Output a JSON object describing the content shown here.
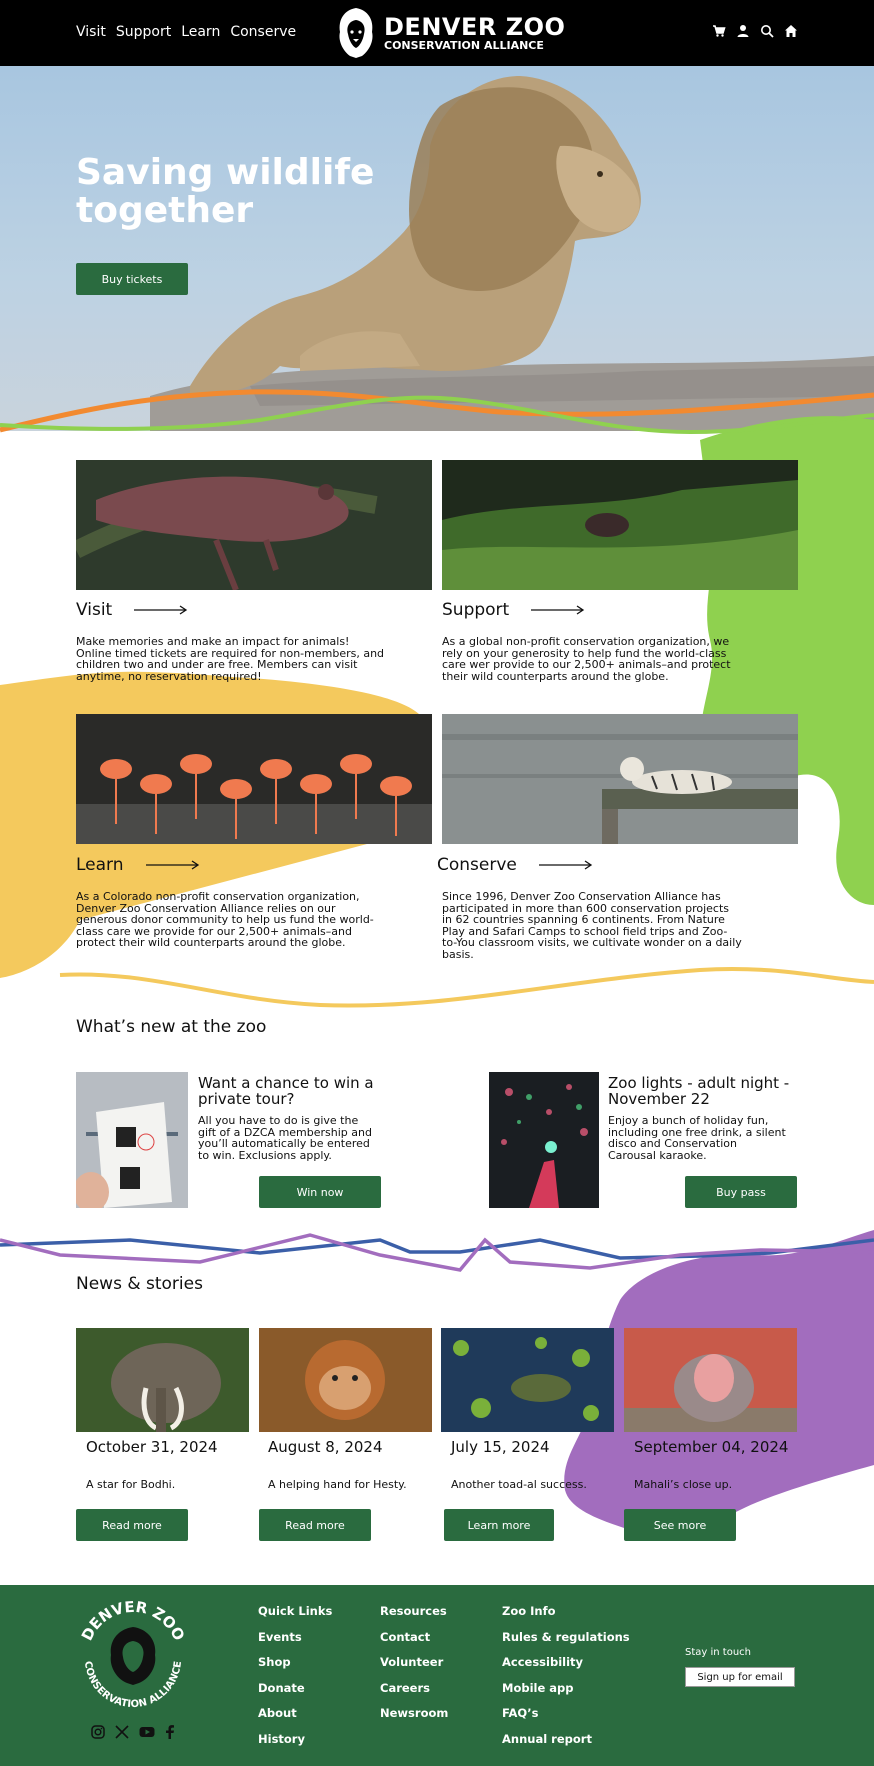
{
  "header": {
    "nav": [
      "Visit",
      "Support",
      "Learn",
      "Conserve"
    ],
    "logo_line1": "DENVER ZOO",
    "logo_line2": "CONSERVATION ALLIANCE",
    "icons": [
      "cart-icon",
      "user-icon",
      "search-icon",
      "home-icon"
    ]
  },
  "hero": {
    "title": "Saving wildlife together",
    "button": "Buy tickets"
  },
  "cards": [
    {
      "title": "Visit",
      "text": "Make memories and make an impact for animals! Online timed tickets are required for non-members, and children two and under are free. Members can visit anytime, no reservation required!"
    },
    {
      "title": "Support",
      "text": "As a global non-profit conservation organization, we rely on your generosity to help fund the world-class care wer provide to our 2,500+ animals–and protect their wild counterparts around the globe."
    },
    {
      "title": "Learn",
      "text": "As a Colorado non-profit conservation organization, Denver Zoo Conservation Alliance relies on our generous donor community to help us fund the world-class care we provide for our 2,500+ animals–and protect their wild counterparts around the globe."
    },
    {
      "title": "Conserve",
      "text": "Since 1996, Denver Zoo Conservation Alliance has participated in more than 600 conservation projects in 62 countries spanning 6 continents. From Nature Play and Safari Camps to school field trips and Zoo-to-You classroom visits, we cultivate wonder on a daily basis."
    }
  ],
  "whats_new": {
    "heading": "What’s new at the zoo",
    "items": [
      {
        "title": "Want a chance to win a private tour?",
        "text": "All you have to do is give the gift of a DZCA membership and you’ll automatically be entered to win. Exclusions apply.",
        "button": "Win now"
      },
      {
        "title": "Zoo lights - adult night - November 22",
        "text": "Enjoy a bunch of holiday fun, including one free drink, a silent disco and Conservation Carousal karaoke.",
        "button": "Buy pass"
      }
    ]
  },
  "news": {
    "heading": "News & stories",
    "items": [
      {
        "date": "October 31, 2024",
        "text": "A star for Bodhi.",
        "button": "Read more"
      },
      {
        "date": "August 8, 2024",
        "text": "A helping hand for Hesty.",
        "button": "Read more"
      },
      {
        "date": "July 15, 2024",
        "text": "Another toad-al success.",
        "button": "Learn more"
      },
      {
        "date": "September 04, 2024",
        "text": "Mahali’s close up.",
        "button": "See more"
      }
    ]
  },
  "footer": {
    "logo_text_top": "DENVER ZOO",
    "logo_text_bottom": "CONSERVATION ALLIANCE",
    "social": [
      "instagram-icon",
      "x-icon",
      "youtube-icon",
      "facebook-icon"
    ],
    "col1": [
      "Quick Links",
      "Events",
      "Shop",
      "Donate",
      "About",
      "History"
    ],
    "col2": [
      "Resources",
      "Contact",
      "Volunteer",
      "Careers",
      "Newsroom"
    ],
    "col3": [
      "Zoo Info",
      "Rules & regulations",
      "Accessibility",
      "Mobile app",
      "FAQ’s",
      "Annual report"
    ],
    "stay_in_touch": "Stay in touch",
    "signup": "Sign up for email"
  },
  "colors": {
    "green": "#2a6b3f",
    "lime": "#8fd14f",
    "yellow": "#f4c95d",
    "purple": "#a26dbe",
    "orange": "#f28a30",
    "blue": "#3b5fa8"
  }
}
